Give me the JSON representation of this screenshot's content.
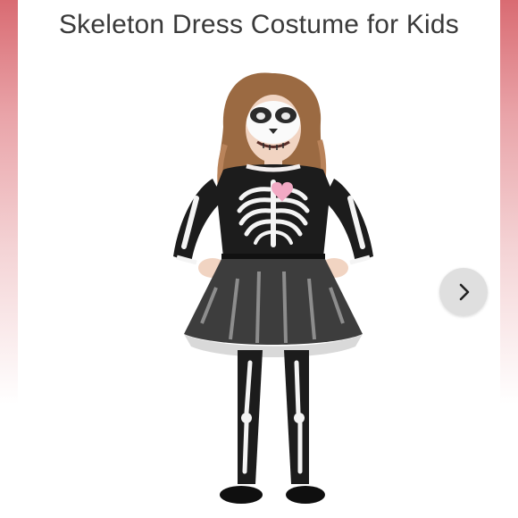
{
  "listing": {
    "title": "Skeleton Dress Costume for Kids"
  },
  "carousel": {
    "next_icon": "chevron-right-icon"
  },
  "colors": {
    "title_text": "#3a3a3a",
    "edge_accent": "#d96b72",
    "costume_black": "#1c1c1c",
    "bone_white": "#f4f4f4",
    "heart_pink": "#f2a9c4"
  }
}
